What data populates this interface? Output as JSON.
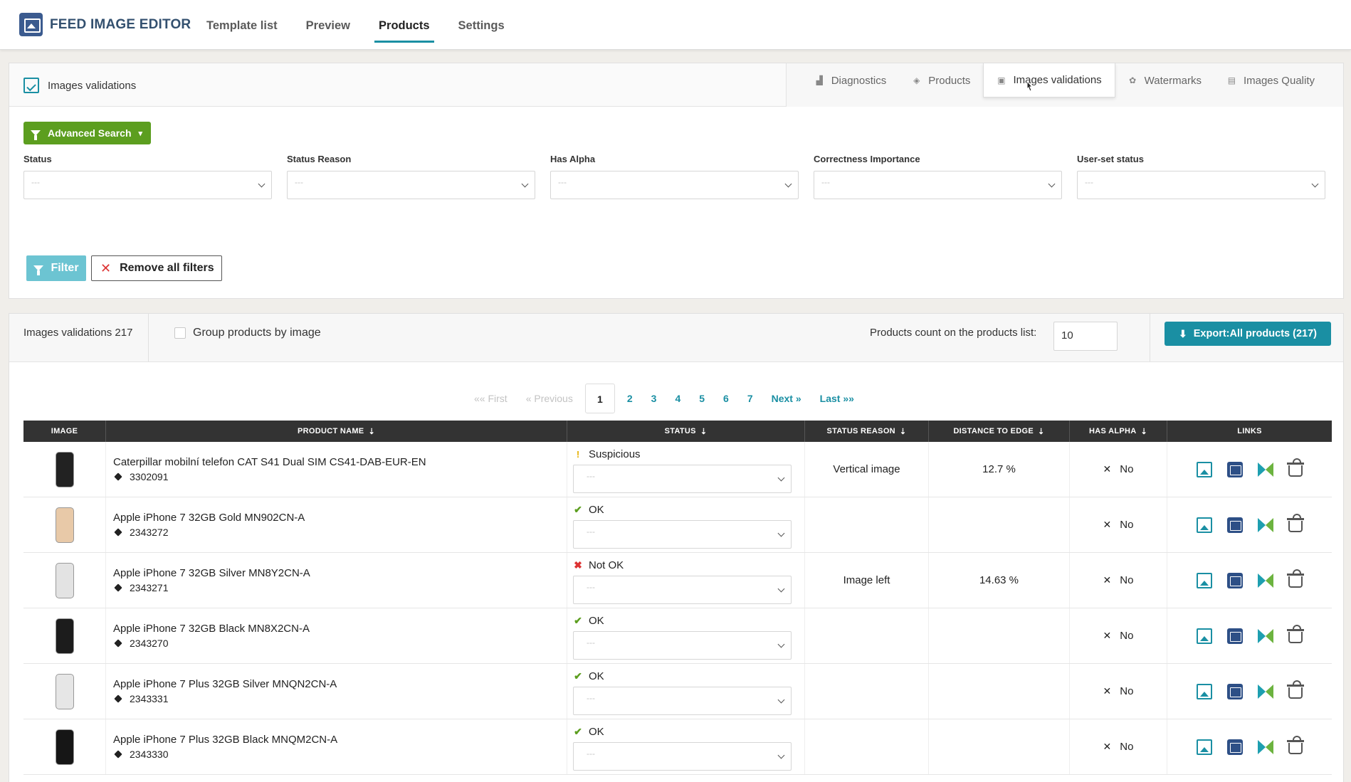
{
  "app": {
    "title": "FEED IMAGE EDITOR",
    "nav": [
      "Template list",
      "Preview",
      "Products",
      "Settings"
    ]
  },
  "panel": {
    "title": "Images validations",
    "tabs": [
      "Diagnostics",
      "Products",
      "Images validations",
      "Watermarks",
      "Images Quality"
    ],
    "advanced_search": "Advanced Search",
    "filters": [
      {
        "label": "Status",
        "value": "---"
      },
      {
        "label": "Status Reason",
        "value": "---"
      },
      {
        "label": "Has Alpha",
        "value": "---"
      },
      {
        "label": "Correctness Importance",
        "value": "---"
      },
      {
        "label": "User-set status",
        "value": "---"
      }
    ],
    "filter_button": "Filter",
    "remove_button": "Remove all filters"
  },
  "list": {
    "count_label": "Images validations 217",
    "group_label": "Group products by image",
    "products_count_label": "Products count on the products list:",
    "products_count_value": "10",
    "export_label": "Export:All products (217)",
    "pagination": {
      "first": "«« First",
      "previous": "« Previous",
      "pages": [
        "1",
        "2",
        "3",
        "4",
        "5",
        "6",
        "7"
      ],
      "current": "1",
      "next": "Next »",
      "last": "Last »»"
    },
    "columns": [
      "IMAGE",
      "PRODUCT NAME",
      "STATUS",
      "STATUS REASON",
      "DISTANCE TO EDGE",
      "HAS ALPHA",
      "LINKS"
    ],
    "rows": [
      {
        "name": "Caterpillar mobilní telefon CAT S41 Dual SIM CS41-DAB-EUR-EN",
        "id": "3302091",
        "status": "Suspicious",
        "status_kind": "suspicious",
        "select": "---",
        "reason": "Vertical image",
        "distance": "12.7 %",
        "alpha": "No",
        "phone_color": "#222"
      },
      {
        "name": "Apple iPhone 7 32GB Gold MN902CN-A",
        "id": "2343272",
        "status": "OK",
        "status_kind": "ok",
        "select": "---",
        "reason": "",
        "distance": "",
        "alpha": "No",
        "phone_color": "#e8c9a8"
      },
      {
        "name": "Apple iPhone 7 32GB Silver MN8Y2CN-A",
        "id": "2343271",
        "status": "Not OK",
        "status_kind": "notok",
        "select": "---",
        "reason": "Image left",
        "distance": "14.63 %",
        "alpha": "No",
        "phone_color": "#e3e3e3"
      },
      {
        "name": "Apple iPhone 7 32GB Black MN8X2CN-A",
        "id": "2343270",
        "status": "OK",
        "status_kind": "ok",
        "select": "---",
        "reason": "",
        "distance": "",
        "alpha": "No",
        "phone_color": "#1c1c1c"
      },
      {
        "name": "Apple iPhone 7 Plus 32GB Silver MNQN2CN-A",
        "id": "2343331",
        "status": "OK",
        "status_kind": "ok",
        "select": "---",
        "reason": "",
        "distance": "",
        "alpha": "No",
        "phone_color": "#e6e6e6"
      },
      {
        "name": "Apple iPhone 7 Plus 32GB Black MNQM2CN-A",
        "id": "2343330",
        "status": "OK",
        "status_kind": "ok",
        "select": "---",
        "reason": "",
        "distance": "",
        "alpha": "No",
        "phone_color": "#161616"
      }
    ]
  },
  "colors": {
    "accent": "#1a8fa3",
    "green": "#5c9e1f",
    "navy": "#2d4f86"
  }
}
